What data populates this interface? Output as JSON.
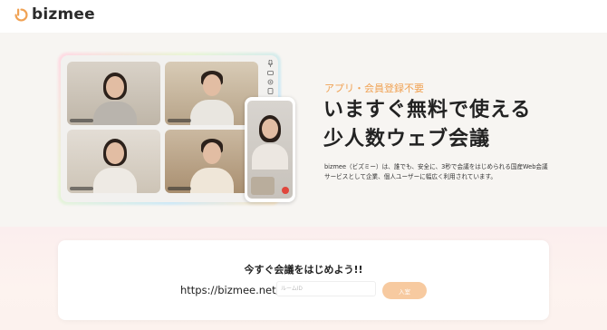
{
  "brand": {
    "name": "bizmee",
    "accent": "#f0a254"
  },
  "hero": {
    "tagline": "アプリ・会員登録不要",
    "headline_line1": "いますぐ無料で使える",
    "headline_line2": "少人数ウェブ会議",
    "description": "bizmee（ビズミー）は、誰でも、安全に、3秒で会議をはじめられる国産Web会議サービスとして企業、個人ユーザーに幅広く利用されています。"
  },
  "join": {
    "title": "今すぐ会議をはじめよう!!",
    "url_prefix": "https://bizmee.net/",
    "room_placeholder": "ルームID",
    "button_label": "入室",
    "button_color": "#f7caa0"
  },
  "mock": {
    "side_controls": [
      "mic-icon",
      "camera-icon",
      "settings-icon",
      "screen-icon"
    ]
  }
}
